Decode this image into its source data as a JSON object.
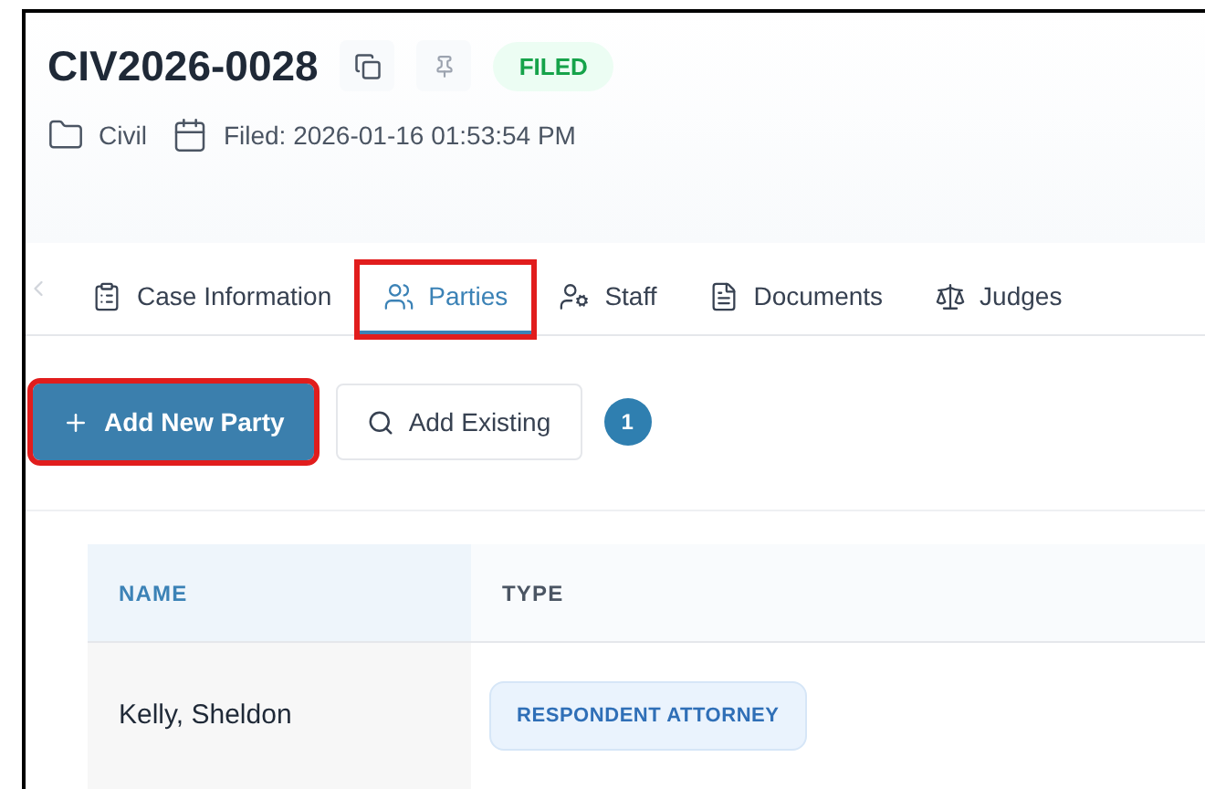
{
  "case": {
    "number": "CIV2026-0028",
    "status": "FILED",
    "category": "Civil",
    "filed": "Filed: 2026-01-16 01:53:54 PM"
  },
  "tabs": [
    {
      "label": "Case Information",
      "kind": "clipboard",
      "selected": false,
      "highlighted": false
    },
    {
      "label": "Parties",
      "kind": "users",
      "selected": true,
      "highlighted": true
    },
    {
      "label": "Staff",
      "kind": "user-gear",
      "selected": false,
      "highlighted": false
    },
    {
      "label": "Documents",
      "kind": "file",
      "selected": false,
      "highlighted": false
    },
    {
      "label": "Judges",
      "kind": "judge",
      "selected": false,
      "highlighted": false
    }
  ],
  "toolbar": {
    "buttons": [
      {
        "label": "Add New Party",
        "kind": "primary",
        "highlighted": true
      },
      {
        "label": "Add Existing",
        "kind": "secondary",
        "highlighted": false
      }
    ],
    "count": "1"
  },
  "table": {
    "columns": [
      "NAME",
      "TYPE"
    ],
    "rows": [
      {
        "name": "Kelly, Sheldon",
        "type": "RESPONDENT ATTORNEY"
      }
    ]
  }
}
